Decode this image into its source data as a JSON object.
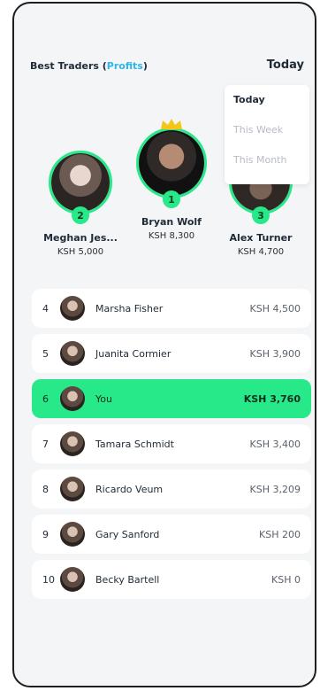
{
  "header": {
    "title_main": "Best Traders (",
    "title_accent": "Profits",
    "title_close": ")",
    "period": "Today"
  },
  "dropdown": {
    "options": [
      "Today",
      "This Week",
      "This Month"
    ],
    "selected": "Today"
  },
  "podium": {
    "first": {
      "rank": "1",
      "name": "Bryan Wolf",
      "amount": "KSH 8,300"
    },
    "second": {
      "rank": "2",
      "name": "Meghan Jes...",
      "amount": "KSH 5,000"
    },
    "third": {
      "rank": "3",
      "name": "Alex Turner",
      "amount": "KSH 4,700"
    }
  },
  "leaderboard": [
    {
      "rank": "4",
      "name": "Marsha Fisher",
      "amount": "KSH 4,500"
    },
    {
      "rank": "5",
      "name": "Juanita Cormier",
      "amount": "KSH 3,900"
    },
    {
      "rank": "6",
      "name": "You",
      "amount": "KSH 3,760"
    },
    {
      "rank": "7",
      "name": "Tamara Schmidt",
      "amount": "KSH 3,400"
    },
    {
      "rank": "8",
      "name": "Ricardo Veum",
      "amount": "KSH 3,209"
    },
    {
      "rank": "9",
      "name": "Gary Sanford",
      "amount": "KSH 200"
    },
    {
      "rank": "10",
      "name": "Becky Bartell",
      "amount": "KSH 0"
    }
  ],
  "colors": {
    "accent_green": "#27e98a",
    "accent_blue": "#2fb6ea",
    "crown_gold": "#f5c518"
  }
}
